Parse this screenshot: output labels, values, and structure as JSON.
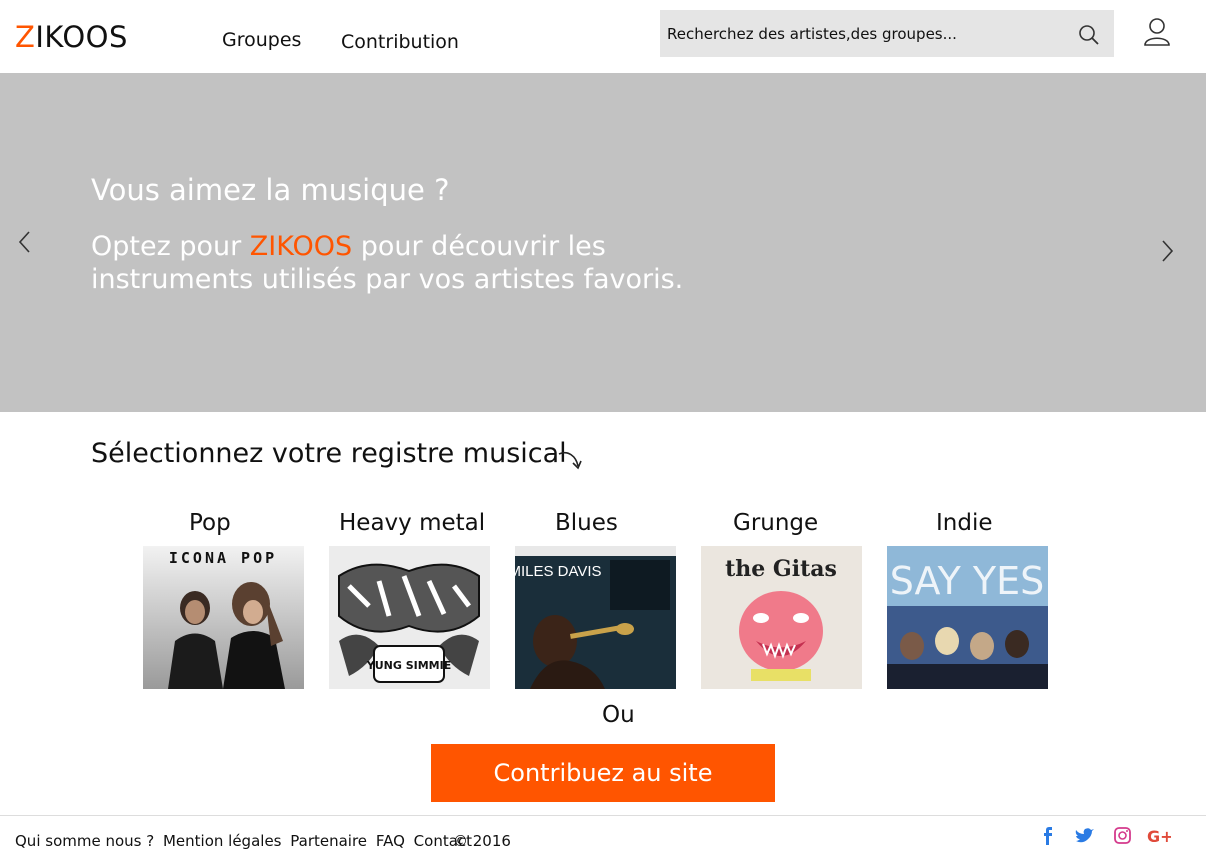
{
  "header": {
    "logo_first": "Z",
    "logo_rest": "IKOOS",
    "nav": [
      "Groupes",
      "Contribution"
    ],
    "search_placeholder": "Recherchez des artistes,des groupes..."
  },
  "hero": {
    "title": "Vous aimez la musique ?",
    "sub_prefix": "Optez pour ",
    "sub_brand": "ZIKOOS",
    "sub_suffix": " pour découvrir les instruments utilisés par vos artistes favoris."
  },
  "genres": {
    "title": "Sélectionnez votre registre musical",
    "items": [
      {
        "label": "Pop",
        "cover_text": "ICONA POP"
      },
      {
        "label": "Heavy metal",
        "cover_text": "YUNG SIMMIE"
      },
      {
        "label": "Blues",
        "cover_text": "MILES DAVIS"
      },
      {
        "label": "Grunge",
        "cover_text": "the Gitas"
      },
      {
        "label": "Indie",
        "cover_text": "SAY YES"
      }
    ]
  },
  "or_label": "Ou",
  "cta_label": "Contribuez au site",
  "footer": {
    "links": [
      "Qui somme nous ?",
      "Mention légales",
      "Partenaire",
      "FAQ",
      "Contact"
    ],
    "copyright": "© 2016"
  },
  "colors": {
    "accent": "#ff5500",
    "hero_bg": "#c2c2c2",
    "search_bg": "#e5e5e5",
    "social": "#2a7be4"
  },
  "icons": [
    "search-icon",
    "user-icon",
    "chevron-left-icon",
    "chevron-right-icon",
    "curved-arrow-icon",
    "facebook-icon",
    "twitter-icon",
    "instagram-icon",
    "google-plus-icon"
  ]
}
